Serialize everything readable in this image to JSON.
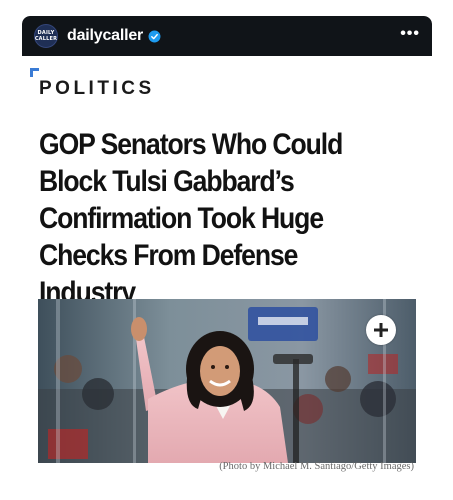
{
  "header": {
    "avatar_text": "DAILY CALLER",
    "username": "dailycaller",
    "more_label": "•••"
  },
  "article": {
    "section": "POLITICS",
    "headline": "GOP Senators Who Could Block Tulsi Gabbard’s Confirmation Took Huge Checks From Defense Industry",
    "photo_caption": "(Photo by Michael M. Santiago/Getty Images)"
  },
  "colors": {
    "topbar": "#101418",
    "verified_badge": "#1d9bf0",
    "section_marker": "#3a7bd5",
    "headline_text": "#121212"
  },
  "icons": {
    "verified": "verified-badge-icon",
    "more": "more-options-icon",
    "expand": "plus-icon"
  }
}
